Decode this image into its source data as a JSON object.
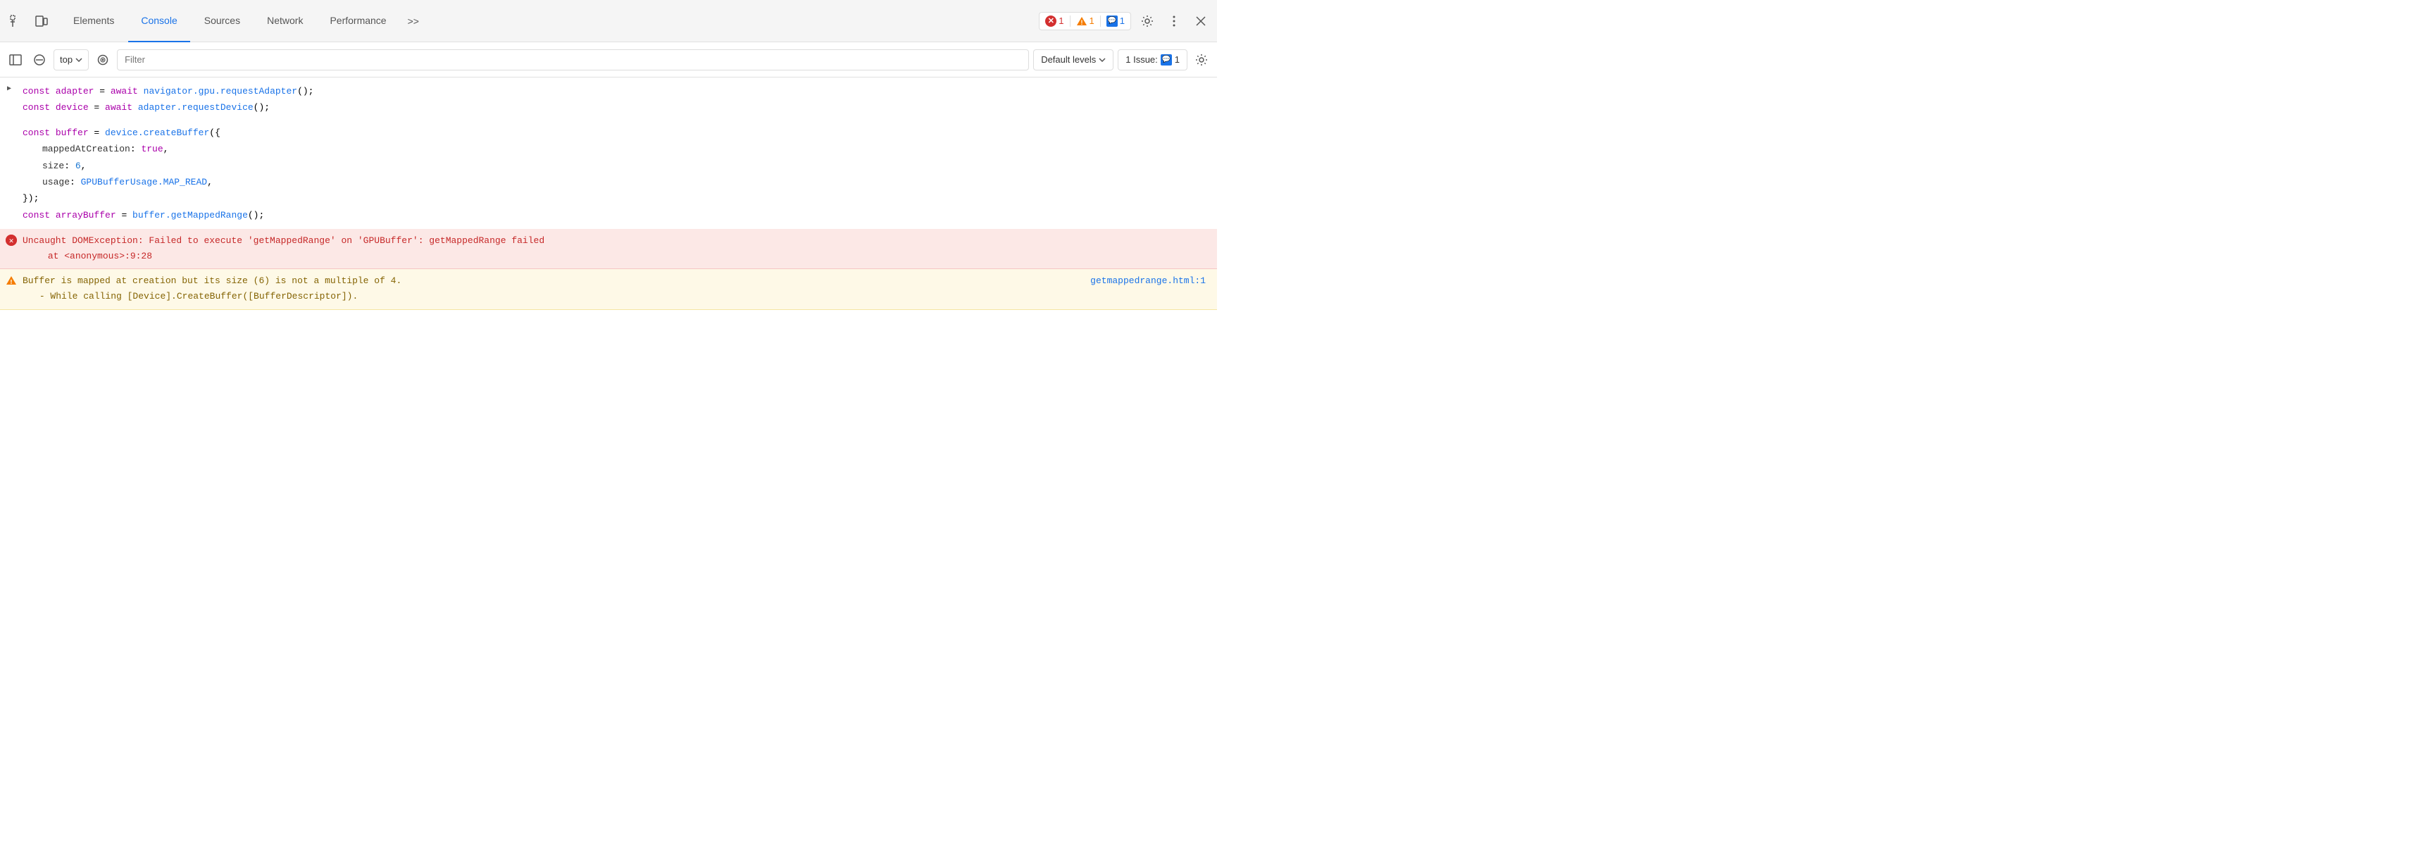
{
  "tabBar": {
    "tabs": [
      {
        "id": "elements",
        "label": "Elements",
        "active": false
      },
      {
        "id": "console",
        "label": "Console",
        "active": true
      },
      {
        "id": "sources",
        "label": "Sources",
        "active": false
      },
      {
        "id": "network",
        "label": "Network",
        "active": false
      },
      {
        "id": "performance",
        "label": "Performance",
        "active": false
      },
      {
        "id": "more",
        "label": ">>",
        "active": false
      }
    ],
    "errorCount": "1",
    "warningCount": "1",
    "messageCount": "1",
    "icons": {
      "inspect": "⬚",
      "device": "⬜"
    }
  },
  "toolbar": {
    "topLabel": "top",
    "filterPlaceholder": "Filter",
    "levelsLabel": "Default levels",
    "issueLabel": "1 Issue:",
    "issueCount": "1"
  },
  "console": {
    "line1_prefix": "const ",
    "line1_var": "adapter",
    "line1_eq": " = ",
    "line1_await": "await ",
    "line1_code": "navigator.gpu.requestAdapter();",
    "line2_prefix": "const ",
    "line2_var": "device",
    "line2_eq": " = ",
    "line2_await": "await ",
    "line2_code": "adapter.requestDevice();",
    "line3_prefix": "const ",
    "line3_var": "buffer",
    "line3_eq": " = ",
    "line3_code": "device.createBuffer({",
    "line4": "  mappedAtCreation: true,",
    "line5": "  size: 6,",
    "line6": "  usage: GPUBufferUsage.MAP_READ,",
    "line7": "});",
    "line8_prefix": "const ",
    "line8_var": "arrayBuffer",
    "line8_eq": " = ",
    "line8_code": "buffer.getMappedRange();",
    "errorMsg": "Uncaught DOMException: Failed to execute 'getMappedRange' on 'GPUBuffer': getMappedRange failed",
    "errorLocation": "at <anonymous>:9:28",
    "warningMsg": "Buffer is mapped at creation but its size (6) is not a multiple of 4.",
    "warningMsg2": "- While calling [Device].CreateBuffer([BufferDescriptor]).",
    "warningLink": "getmappedrange.html:1"
  }
}
